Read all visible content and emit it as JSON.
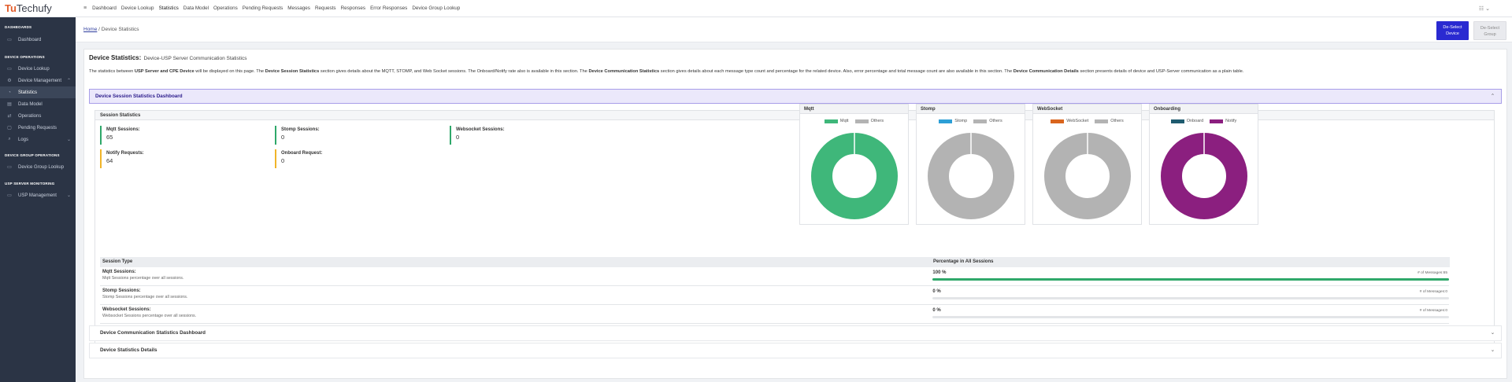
{
  "brand": {
    "prefix": "Tu",
    "rest": "Techufy"
  },
  "sidebar": {
    "sections": [
      {
        "title": "DASHBOARDS",
        "items": [
          {
            "label": "Dashboard",
            "icon": "dashboard-icon"
          }
        ]
      },
      {
        "title": "DEVICE OPERATIONS",
        "items": [
          {
            "label": "Device Lookup",
            "icon": "lookup-icon"
          },
          {
            "label": "Device Management",
            "icon": "management-icon"
          },
          {
            "label": "Statistics",
            "icon": "statistics-icon"
          },
          {
            "label": "Data Model",
            "icon": "data-model-icon"
          },
          {
            "label": "Operations",
            "icon": "operations-icon"
          },
          {
            "label": "Pending Requests",
            "icon": "pending-icon"
          },
          {
            "label": "Logs",
            "icon": "logs-icon"
          }
        ]
      },
      {
        "title": "DEVICE GROUP OPERATIONS",
        "items": [
          {
            "label": "Device Group Lookup",
            "icon": "group-icon"
          }
        ]
      },
      {
        "title": "USP SERVER MONITORING",
        "items": [
          {
            "label": "USP Management",
            "icon": "server-icon"
          }
        ]
      }
    ]
  },
  "topnav": [
    "Dashboard",
    "Device Lookup",
    "Statistics",
    "Data Model",
    "Operations",
    "Pending Requests",
    "Messages",
    "Requests",
    "Responses",
    "Error Responses",
    "Device Group Lookup"
  ],
  "breadcrumb": {
    "home": "Home",
    "sep": "/",
    "current": "Device Statistics"
  },
  "buttons": {
    "deselect_device_1": "De-Select",
    "deselect_device_2": "Device",
    "deselect_group_1": "De-Select",
    "deselect_group_2": "Group"
  },
  "page": {
    "title": "Device Statistics:",
    "subtitle": "Device-USP Server Communication Statistics",
    "desc": {
      "p1": "The statistics between ",
      "b1": "USP Server and CPE Device",
      "p2": " will be displayed on this page. The ",
      "b2": "Device Session Statistics",
      "p3": " section gives details about the MQTT, STOMP, and Web Socket sessions. The Onboard/Notify rate also is available in this section. The ",
      "b3": "Device Communication Statistics",
      "p4": " section gives details about each message type count and percentage for the related device. Also, error percentage and total message count are also available in this section. The ",
      "b4": "Device Communication Details",
      "p5": " section presents details of device and USP-Server communication as a plain table."
    }
  },
  "session_dashboard": {
    "title": "Device Session Statistics Dashboard",
    "panel_title": "Session Statistics",
    "stats": [
      {
        "label": "Mqtt Sessions:",
        "value": "65"
      },
      {
        "label": "Stomp Sessions:",
        "value": "0"
      },
      {
        "label": "Websocket Sessions:",
        "value": "0"
      },
      {
        "label": "Notify Requests:",
        "value": "64"
      },
      {
        "label": "Onboard Request:",
        "value": "0"
      }
    ]
  },
  "chart_data": [
    {
      "type": "pie",
      "title": "Mqtt",
      "labels": [
        "Mqtt",
        "Others"
      ],
      "values": [
        65,
        0
      ],
      "colors": [
        "#3fb77a",
        "#b3b3b3"
      ],
      "donut": true
    },
    {
      "type": "pie",
      "title": "Stomp",
      "labels": [
        "Stomp",
        "Others"
      ],
      "values": [
        0,
        65
      ],
      "colors": [
        "#2d9fd6",
        "#b3b3b3"
      ],
      "donut": true
    },
    {
      "type": "pie",
      "title": "WebSocket",
      "labels": [
        "WebSocket",
        "Others"
      ],
      "values": [
        0,
        65
      ],
      "colors": [
        "#d9651d",
        "#b3b3b3"
      ],
      "donut": true
    },
    {
      "type": "pie",
      "title": "Onboarding",
      "labels": [
        "Onboard",
        "Notify"
      ],
      "values": [
        0,
        64
      ],
      "colors": [
        "#1f5b6f",
        "#8b1f7f"
      ],
      "donut": true
    }
  ],
  "session_table": {
    "headers": [
      "Session Type",
      "Percentage in All Sessions"
    ],
    "rows": [
      {
        "type": "Mqtt Sessions:",
        "desc": "Mqtt Sessions percentage over all sessions.",
        "pct": "100 %",
        "pct_value": 100,
        "msgs_label": "# of Messages:",
        "msgs": "65"
      },
      {
        "type": "Stomp Sessions:",
        "desc": "Stomp Sessions percentage over all sessions.",
        "pct": "0 %",
        "pct_value": 0,
        "msgs_label": "# of Messages:",
        "msgs": "0"
      },
      {
        "type": "Websocket Sessions:",
        "desc": "Websocket Sessions percentage over all sessions.",
        "pct": "0 %",
        "pct_value": 0,
        "msgs_label": "# of Messages:",
        "msgs": "0"
      }
    ]
  },
  "accordions": [
    "Device Communication Statistics Dashboard",
    "Device Statistics Details"
  ]
}
